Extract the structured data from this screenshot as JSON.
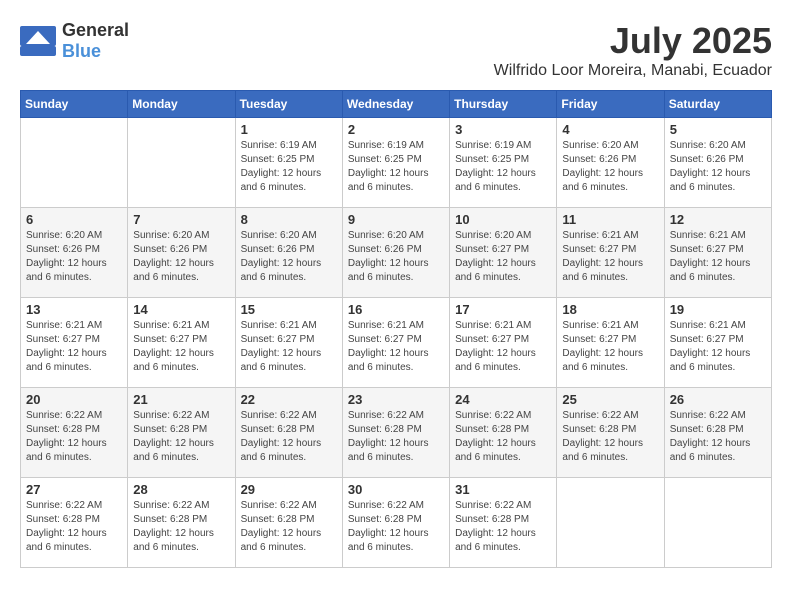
{
  "header": {
    "logo": {
      "general": "General",
      "blue": "Blue"
    },
    "month": "July 2025",
    "location": "Wilfrido Loor Moreira, Manabi, Ecuador"
  },
  "days_of_week": [
    "Sunday",
    "Monday",
    "Tuesday",
    "Wednesday",
    "Thursday",
    "Friday",
    "Saturday"
  ],
  "weeks": [
    [
      {
        "day": "",
        "info": ""
      },
      {
        "day": "",
        "info": ""
      },
      {
        "day": "1",
        "info": "Sunrise: 6:19 AM\nSunset: 6:25 PM\nDaylight: 12 hours\nand 6 minutes."
      },
      {
        "day": "2",
        "info": "Sunrise: 6:19 AM\nSunset: 6:25 PM\nDaylight: 12 hours\nand 6 minutes."
      },
      {
        "day": "3",
        "info": "Sunrise: 6:19 AM\nSunset: 6:25 PM\nDaylight: 12 hours\nand 6 minutes."
      },
      {
        "day": "4",
        "info": "Sunrise: 6:20 AM\nSunset: 6:26 PM\nDaylight: 12 hours\nand 6 minutes."
      },
      {
        "day": "5",
        "info": "Sunrise: 6:20 AM\nSunset: 6:26 PM\nDaylight: 12 hours\nand 6 minutes."
      }
    ],
    [
      {
        "day": "6",
        "info": "Sunrise: 6:20 AM\nSunset: 6:26 PM\nDaylight: 12 hours\nand 6 minutes."
      },
      {
        "day": "7",
        "info": "Sunrise: 6:20 AM\nSunset: 6:26 PM\nDaylight: 12 hours\nand 6 minutes."
      },
      {
        "day": "8",
        "info": "Sunrise: 6:20 AM\nSunset: 6:26 PM\nDaylight: 12 hours\nand 6 minutes."
      },
      {
        "day": "9",
        "info": "Sunrise: 6:20 AM\nSunset: 6:26 PM\nDaylight: 12 hours\nand 6 minutes."
      },
      {
        "day": "10",
        "info": "Sunrise: 6:20 AM\nSunset: 6:27 PM\nDaylight: 12 hours\nand 6 minutes."
      },
      {
        "day": "11",
        "info": "Sunrise: 6:21 AM\nSunset: 6:27 PM\nDaylight: 12 hours\nand 6 minutes."
      },
      {
        "day": "12",
        "info": "Sunrise: 6:21 AM\nSunset: 6:27 PM\nDaylight: 12 hours\nand 6 minutes."
      }
    ],
    [
      {
        "day": "13",
        "info": "Sunrise: 6:21 AM\nSunset: 6:27 PM\nDaylight: 12 hours\nand 6 minutes."
      },
      {
        "day": "14",
        "info": "Sunrise: 6:21 AM\nSunset: 6:27 PM\nDaylight: 12 hours\nand 6 minutes."
      },
      {
        "day": "15",
        "info": "Sunrise: 6:21 AM\nSunset: 6:27 PM\nDaylight: 12 hours\nand 6 minutes."
      },
      {
        "day": "16",
        "info": "Sunrise: 6:21 AM\nSunset: 6:27 PM\nDaylight: 12 hours\nand 6 minutes."
      },
      {
        "day": "17",
        "info": "Sunrise: 6:21 AM\nSunset: 6:27 PM\nDaylight: 12 hours\nand 6 minutes."
      },
      {
        "day": "18",
        "info": "Sunrise: 6:21 AM\nSunset: 6:27 PM\nDaylight: 12 hours\nand 6 minutes."
      },
      {
        "day": "19",
        "info": "Sunrise: 6:21 AM\nSunset: 6:27 PM\nDaylight: 12 hours\nand 6 minutes."
      }
    ],
    [
      {
        "day": "20",
        "info": "Sunrise: 6:22 AM\nSunset: 6:28 PM\nDaylight: 12 hours\nand 6 minutes."
      },
      {
        "day": "21",
        "info": "Sunrise: 6:22 AM\nSunset: 6:28 PM\nDaylight: 12 hours\nand 6 minutes."
      },
      {
        "day": "22",
        "info": "Sunrise: 6:22 AM\nSunset: 6:28 PM\nDaylight: 12 hours\nand 6 minutes."
      },
      {
        "day": "23",
        "info": "Sunrise: 6:22 AM\nSunset: 6:28 PM\nDaylight: 12 hours\nand 6 minutes."
      },
      {
        "day": "24",
        "info": "Sunrise: 6:22 AM\nSunset: 6:28 PM\nDaylight: 12 hours\nand 6 minutes."
      },
      {
        "day": "25",
        "info": "Sunrise: 6:22 AM\nSunset: 6:28 PM\nDaylight: 12 hours\nand 6 minutes."
      },
      {
        "day": "26",
        "info": "Sunrise: 6:22 AM\nSunset: 6:28 PM\nDaylight: 12 hours\nand 6 minutes."
      }
    ],
    [
      {
        "day": "27",
        "info": "Sunrise: 6:22 AM\nSunset: 6:28 PM\nDaylight: 12 hours\nand 6 minutes."
      },
      {
        "day": "28",
        "info": "Sunrise: 6:22 AM\nSunset: 6:28 PM\nDaylight: 12 hours\nand 6 minutes."
      },
      {
        "day": "29",
        "info": "Sunrise: 6:22 AM\nSunset: 6:28 PM\nDaylight: 12 hours\nand 6 minutes."
      },
      {
        "day": "30",
        "info": "Sunrise: 6:22 AM\nSunset: 6:28 PM\nDaylight: 12 hours\nand 6 minutes."
      },
      {
        "day": "31",
        "info": "Sunrise: 6:22 AM\nSunset: 6:28 PM\nDaylight: 12 hours\nand 6 minutes."
      },
      {
        "day": "",
        "info": ""
      },
      {
        "day": "",
        "info": ""
      }
    ]
  ]
}
